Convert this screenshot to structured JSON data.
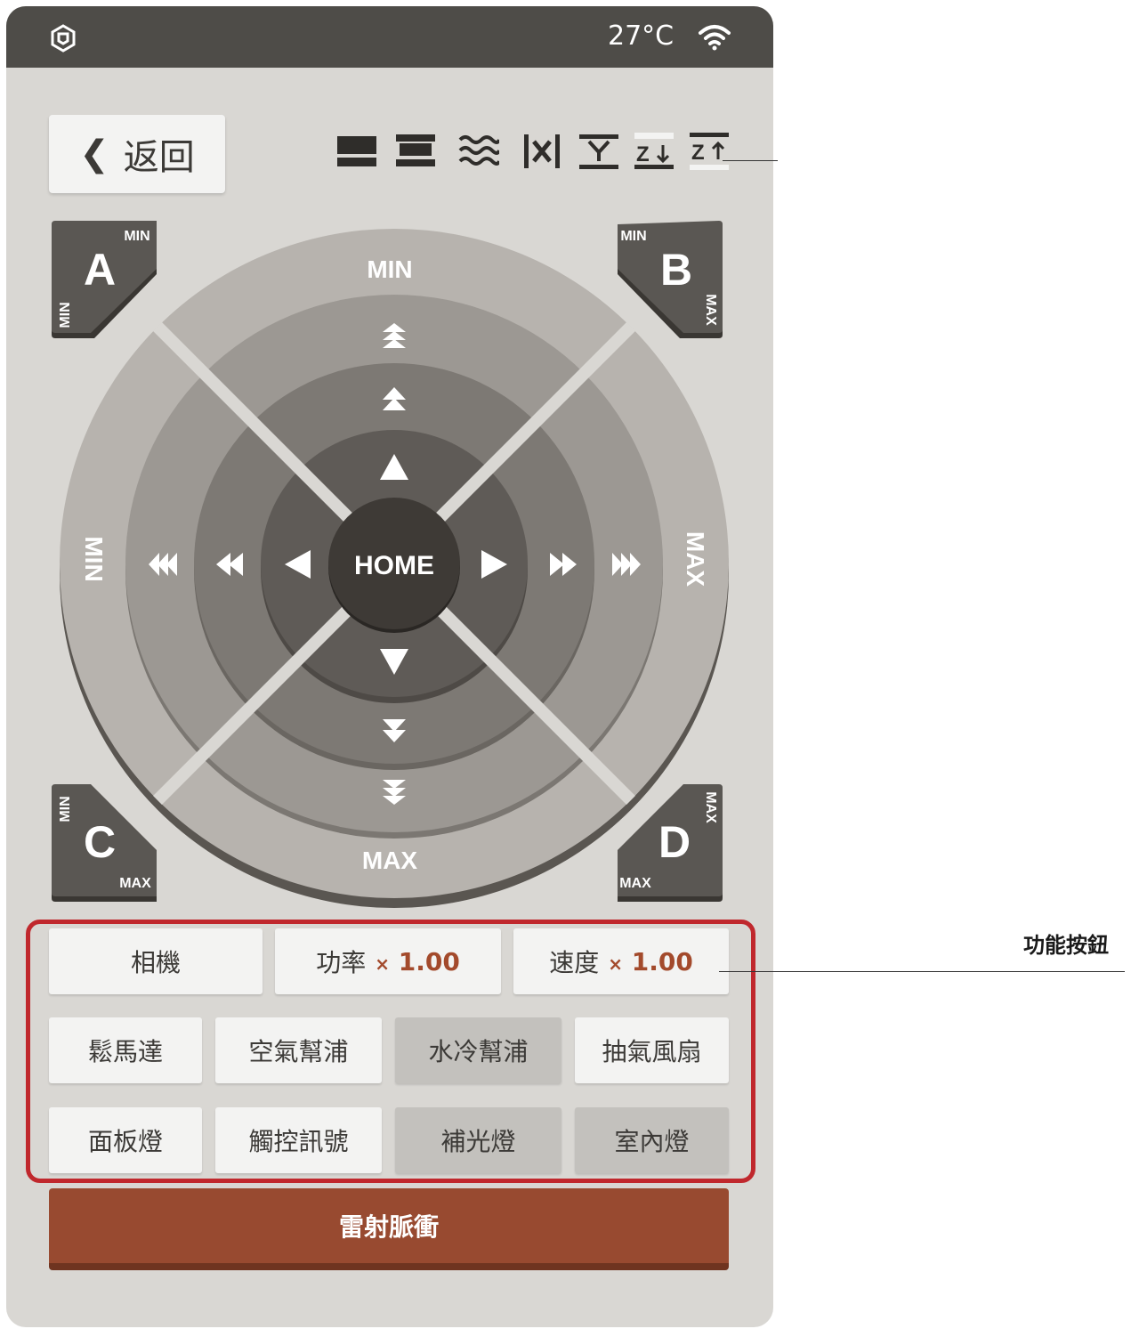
{
  "statusbar": {
    "temperature": "27°C",
    "logo_icon": "app-logo-icon",
    "wifi_icon": "wifi-icon"
  },
  "nav": {
    "back_label": "返回"
  },
  "toolbar": {
    "icons": [
      "bed-flat-icon",
      "bed-raised-icon",
      "air-assist-icon",
      "x-axis-icon",
      "y-axis-icon",
      "z-down-icon",
      "z-up-icon"
    ]
  },
  "joystick": {
    "home_label": "HOME",
    "top_label": "MIN",
    "bottom_label": "MAX",
    "left_label": "MIN",
    "right_label": "MAX",
    "corners": {
      "a": {
        "letter": "A",
        "top": "MIN",
        "side": "MIN"
      },
      "b": {
        "letter": "B",
        "top": "MIN",
        "side": "MAX"
      },
      "c": {
        "letter": "C",
        "top": "MIN",
        "bottom": "MAX"
      },
      "d": {
        "letter": "D",
        "side": "MAX",
        "bottom": "MAX"
      }
    }
  },
  "functions": {
    "camera": "相機",
    "power_label": "功率",
    "power_value": "1.00",
    "speed_label": "速度",
    "speed_value": "1.00",
    "mult_symbol": "×",
    "row2": [
      "鬆馬達",
      "空氣幫浦",
      "水冷幫浦",
      "抽氣風扇"
    ],
    "row3": [
      "面板燈",
      "觸控訊號",
      "補光燈",
      "室內燈"
    ]
  },
  "laser_button": "雷射脈衝",
  "annotation": {
    "label": "功能按鈕"
  },
  "colors": {
    "accent": "#984a30",
    "highlight_border": "#c0282d",
    "statusbar": "#4e4c48"
  }
}
